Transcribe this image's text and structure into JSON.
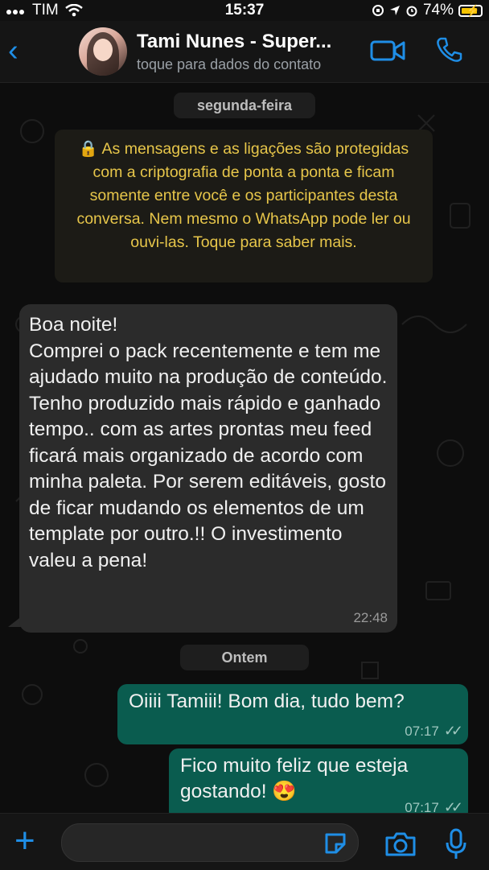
{
  "status_bar": {
    "carrier": "TIM",
    "time": "15:37",
    "battery": "74%"
  },
  "header": {
    "contact_name": "Tami Nunes - Super...",
    "subtitle": "toque para dados do contato"
  },
  "chat": {
    "date_pill_1": "segunda-feira",
    "encryption_notice": "🔒 As mensagens e as ligações são protegidas com a criptografia de ponta a ponta e ficam somente entre você e os participantes desta conversa. Nem mesmo o WhatsApp pode ler ou ouvi-las. Toque para saber mais.",
    "incoming_message": {
      "text": "Boa noite!\nComprei o pack recentemente e tem me ajudado muito na produção de conteúdo. Tenho produzido mais rápido e ganhado tempo.. com as artes prontas meu feed ficará mais organizado de acordo com minha paleta. Por serem editáveis, gosto de ficar mudando os elementos de um template por outro.!! O investimento valeu a pena!",
      "time": "22:48"
    },
    "date_pill_2": "Ontem",
    "outgoing_messages": [
      {
        "text": "Oiiii Tamiii! Bom dia, tudo bem?",
        "time": "07:17"
      },
      {
        "text": "Fico muito feliz que esteja gostando! 😍",
        "time": "07:17"
      }
    ]
  },
  "colors": {
    "accent": "#1f8ee6",
    "outgoing_bubble": "#0a5c4f",
    "incoming_bubble": "#2b2b2b",
    "encryption_text": "#e7c64a"
  }
}
